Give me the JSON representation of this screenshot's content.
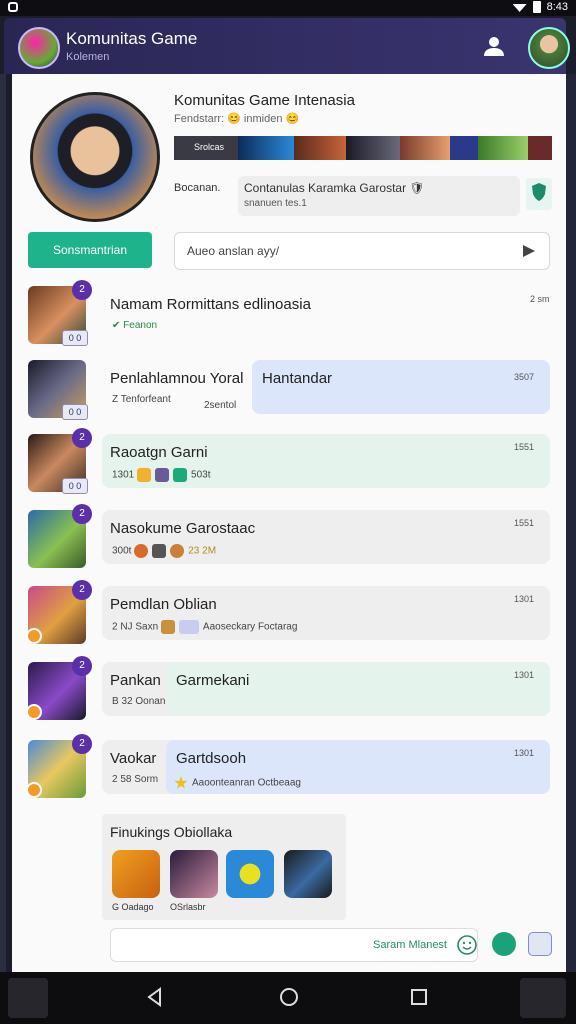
{
  "status": {
    "time": "8:43"
  },
  "header": {
    "title": "Komunitas Game",
    "subtitle": "Kolemen"
  },
  "profile": {
    "title": "Komunitas Game Intenasia",
    "followers": "Fendstarr: 😊 inmiden 😊",
    "strip_label": "Srolcas",
    "description_label": "Bocanan.",
    "description_text": "Contanulas Karamka Garostar 🛡",
    "description_sub": "snanuen tes.1",
    "cta_label": "Sonsmantrian",
    "search_placeholder": "Aueo anslan ayy/"
  },
  "rows": [
    {
      "badge": "2",
      "sub": "0 0",
      "name": "Namam Rormittans edlinoasia",
      "meta": "✔ Feanon",
      "bubble_text": "",
      "time": "2 sm"
    },
    {
      "badge": "",
      "sub": "0 0",
      "name": "Penlahlamnou Yoral",
      "meta": "Z Tenforfeant",
      "extra_meta": "2sentol",
      "bubble_text": "Hantandar",
      "time": "3507"
    },
    {
      "badge": "2",
      "sub": "0 0",
      "name": "Raoatgn Garni",
      "meta": "1301",
      "extra_meta": "503t",
      "bubble_text": "",
      "time": "1551"
    },
    {
      "badge": "2",
      "sub": "",
      "name": "Nasokume Garostaac",
      "meta": "300t",
      "extra_meta": "23 2M",
      "bubble_text": "",
      "time": "1551"
    },
    {
      "badge": "2",
      "sub": "",
      "name": "Pemdlan Oblian",
      "meta": "2 NJ Saxn",
      "extra_meta": "Aaoseckary Foctarag",
      "bubble_text": "",
      "time": "1301"
    },
    {
      "badge": "2",
      "sub": "",
      "name": "Pankan",
      "meta": "B 32 Oonan",
      "extra_meta": "",
      "bubble_text": "Garmekani",
      "time": "1301"
    },
    {
      "badge": "2",
      "sub": "",
      "name": "Vaokar",
      "meta": "2 58 Sorm",
      "extra_meta": "Aaoonteanran Octbeaag",
      "bubble_text": "Gartdsooh",
      "time": "1301"
    }
  ],
  "recommended": {
    "title": "Finukings Obiollaka",
    "labels": [
      "G Oadago",
      "OSrlasbr",
      "",
      ""
    ]
  },
  "composer": {
    "placeholder": "Saram Mlanest"
  },
  "colors": {
    "appbar": "#2a2654",
    "accent_green": "#1fb38b",
    "blue_bubble": "#dbe6fa",
    "green_bubble": "#e4f3ec",
    "badge_purple": "#5b2fa8"
  }
}
